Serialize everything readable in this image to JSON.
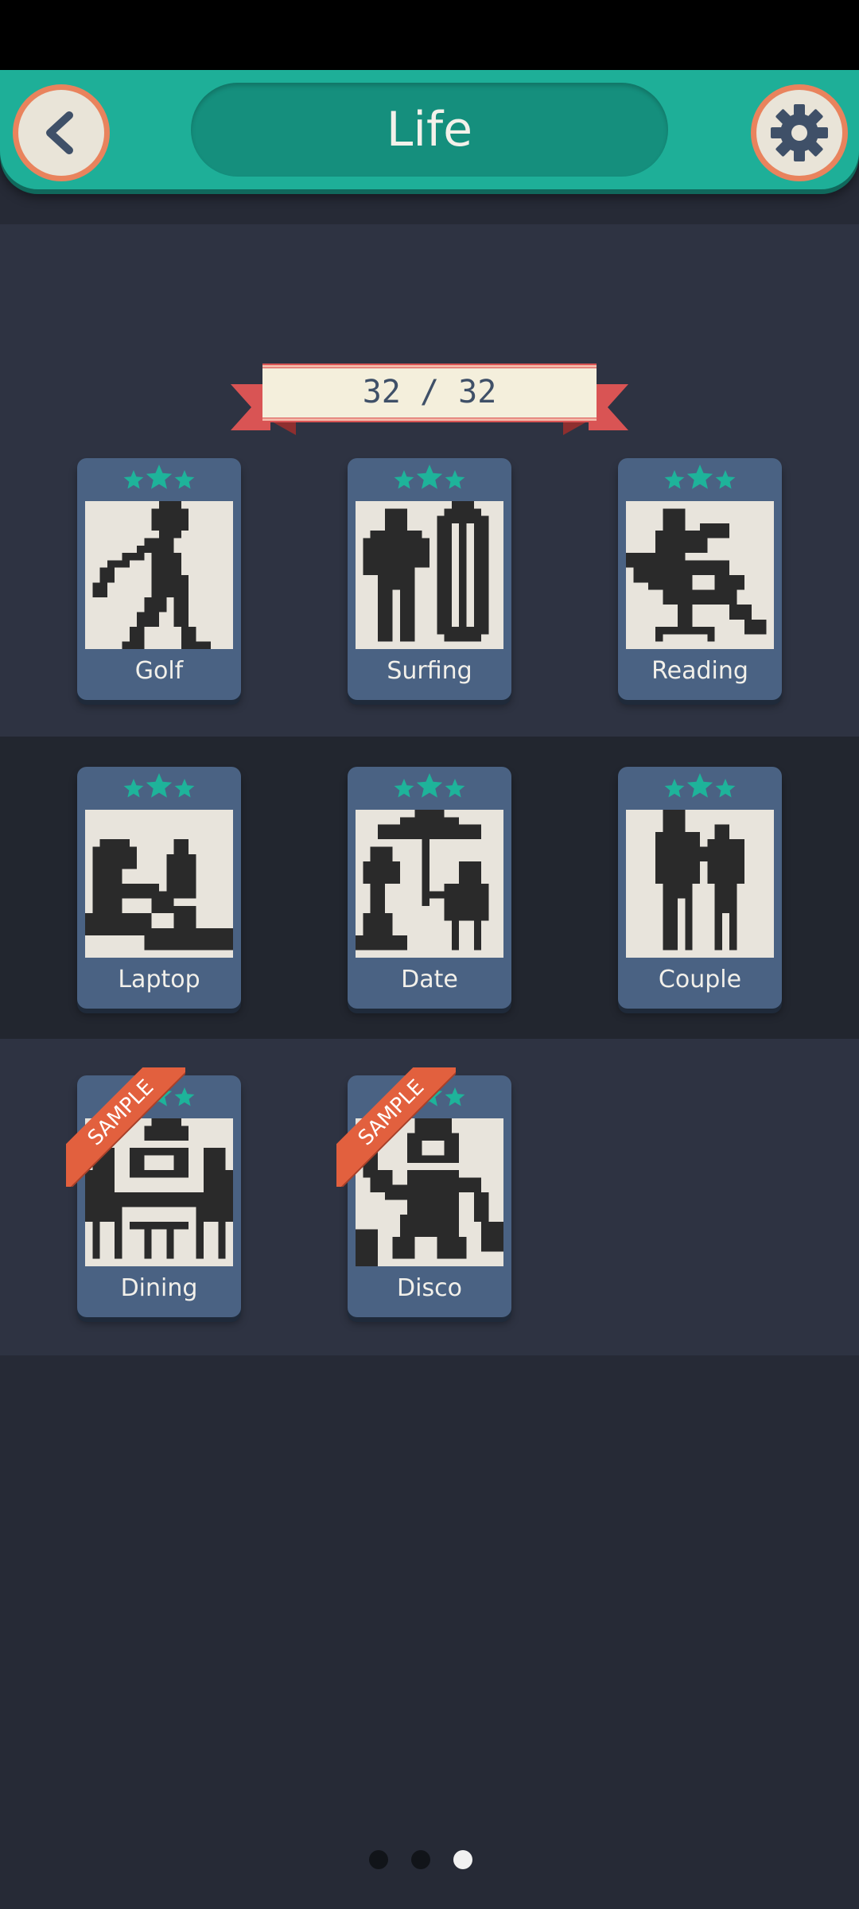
{
  "header": {
    "title": "Life",
    "back_icon": "chevron-left-icon",
    "settings_icon": "gear-icon"
  },
  "progress": {
    "text": "32 / 32",
    "completed": 32,
    "total": 32
  },
  "puzzles": [
    {
      "label": "Golf",
      "stars": 3,
      "sample": false
    },
    {
      "label": "Surfing",
      "stars": 3,
      "sample": false
    },
    {
      "label": "Reading",
      "stars": 3,
      "sample": false
    },
    {
      "label": "Laptop",
      "stars": 3,
      "sample": false
    },
    {
      "label": "Date",
      "stars": 3,
      "sample": false
    },
    {
      "label": "Couple",
      "stars": 3,
      "sample": false
    },
    {
      "label": "Dining",
      "stars": 3,
      "sample": true,
      "badge": "SAMPLE"
    },
    {
      "label": "Disco",
      "stars": 3,
      "sample": true,
      "badge": "SAMPLE"
    }
  ],
  "pagination": {
    "pages": 3,
    "current": 3
  },
  "colors": {
    "header": "#1eaf98",
    "star": "#1eb39a",
    "card": "#4a6283",
    "sample_ribbon": "#e2603e",
    "background": "#262a36"
  }
}
